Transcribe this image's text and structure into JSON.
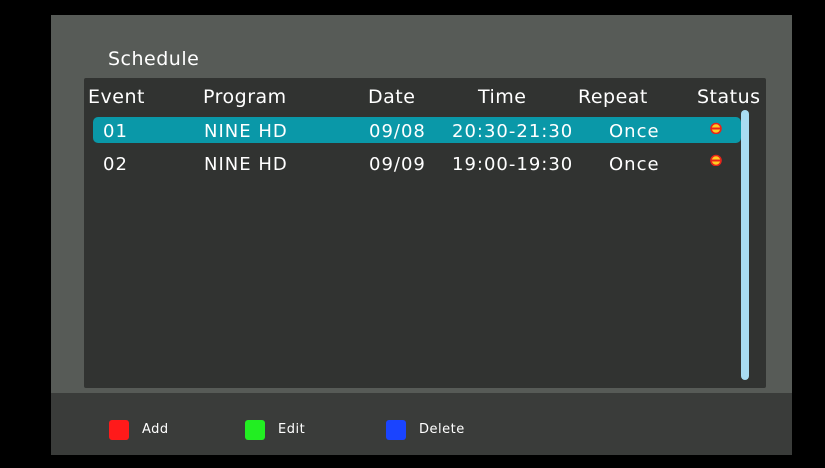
{
  "header": {
    "title": "Schedule"
  },
  "table": {
    "columns": [
      "Event",
      "Program",
      "Date",
      "Time",
      "Repeat",
      "Status"
    ],
    "rows": [
      {
        "event": "01",
        "program": "NINE HD",
        "date": "09/08",
        "time": "20:30-21:30",
        "repeat": "Once",
        "status": "alarm-clock-icon"
      },
      {
        "event": "02",
        "program": "NINE HD",
        "date": "09/09",
        "time": "19:00-19:30",
        "repeat": "Once",
        "status": "alarm-clock-icon"
      }
    ],
    "selected_row": 0
  },
  "footer": {
    "add_label": "Add",
    "edit_label": "Edit",
    "delete_label": "Delete"
  },
  "colors": {
    "background": "#575b57",
    "panel": "#313331",
    "selection": "#0a98a8",
    "scrollbar": "#a8dcf2",
    "key_red": "#ff1a1a",
    "key_green": "#22ee22",
    "key_blue": "#1a44ff"
  }
}
